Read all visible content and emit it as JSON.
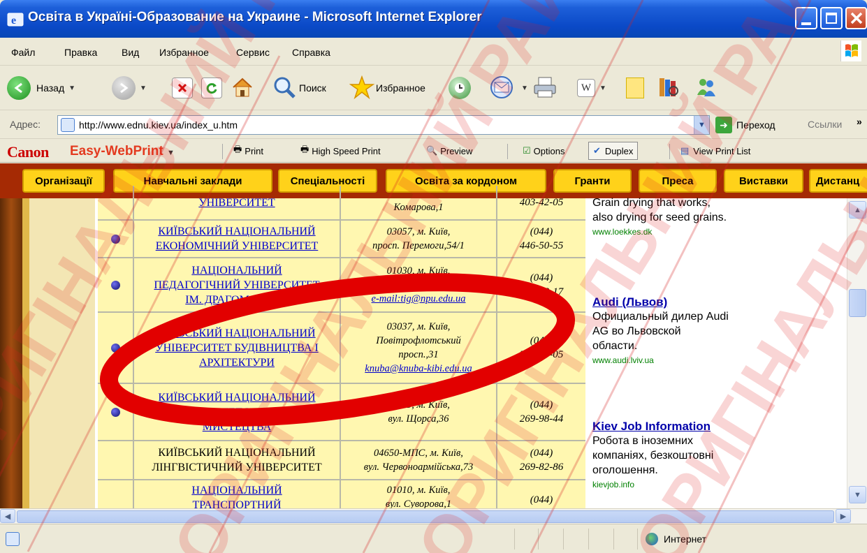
{
  "window": {
    "title": "Освіта в Україні-Образование на Украине - Microsoft Internet Explorer"
  },
  "menu": [
    "Файл",
    "Правка",
    "Вид",
    "Избранное",
    "Сервис",
    "Справка"
  ],
  "toolbar": {
    "back_label": "Назад",
    "search_label": "Поиск",
    "favorites_label": "Избранное"
  },
  "address": {
    "label": "Адрес:",
    "url": "http://www.ednu.kiev.ua/index_u.htm",
    "go_label": "Переход",
    "links_label": "Ссылки"
  },
  "canon": {
    "logo": "Canon",
    "product": "Easy-WebPrint",
    "buttons": [
      "Print",
      "High Speed Print",
      "Preview",
      "Options",
      "Duplex",
      "View Print List"
    ]
  },
  "nav": [
    "Організації",
    "Навчальні заклади",
    "Спеціальності",
    "Освіта за кордоном",
    "Гранти",
    "Преса",
    "Виставки",
    "Дистанц"
  ],
  "rows": [
    {
      "name": [
        "УНІВЕРСИТЕТ"
      ],
      "name_link": true,
      "addr": [
        "Комарова,1"
      ],
      "email": "",
      "phone": [
        "403-42-05"
      ]
    },
    {
      "name": [
        "КИЇВСЬКИЙ НАЦІОНАЛЬНИЙ",
        "ЕКОНОМІЧНИЙ УНІВЕРСИТЕТ"
      ],
      "name_link": true,
      "addr": [
        "03057, м. Київ,",
        "просп. Перемоги,54/1"
      ],
      "email": "",
      "phone": [
        "(044)",
        "446-50-55"
      ]
    },
    {
      "name": [
        "НАЦІОНАЛЬНИЙ",
        "ПЕДАГОГІЧНИЙ УНІВЕРСИТЕТ",
        "ІМ. ДРАГОМАНОВА"
      ],
      "name_link": true,
      "addr": [
        "01030, м. Київ,",
        "вул. Пирогова, 9"
      ],
      "email": "e-mail:tig@npu.edu.ua",
      "phone": [
        "(044)",
        "239-30-17"
      ]
    },
    {
      "name": [
        "КИЇВСЬКИЙ НАЦІОНАЛЬНИЙ",
        "УНІВЕРСИТЕТ БУДІВНИЦТВА І",
        "АРХІТЕКТУРИ"
      ],
      "name_link": true,
      "addr": [
        "03037, м. Київ,",
        "Повітрофлотський",
        "просп.,31"
      ],
      "email": "knuba@knuba-kibi.edu.ua",
      "phone": [
        "(044)",
        "248-49-05"
      ]
    },
    {
      "name": [
        "КИЇВСЬКИЙ НАЦІОНАЛЬНИЙ",
        "УНІВЕРСИТЕТ КУЛЬТУРИ І",
        "МИСТЕЦТВА"
      ],
      "name_link": true,
      "addr": [
        "01133, м. Київ,",
        "вул. Щорса,36"
      ],
      "email": "",
      "phone": [
        "(044)",
        "269-98-44"
      ]
    },
    {
      "name": [
        "КИЇВСЬКИЙ НАЦІОНАЛЬНИЙ",
        "ЛІНГВІСТИЧНИЙ УНІВЕРСИТЕТ"
      ],
      "name_link": false,
      "addr": [
        "04650-МПС, м. Київ,",
        "вул. Червоноармійська,73"
      ],
      "email": "",
      "phone": [
        "(044)",
        "269-82-86"
      ]
    },
    {
      "name": [
        "НАЦІОНАЛЬНИЙ",
        "ТРАНСПОРТНИЙ"
      ],
      "name_link": true,
      "addr": [
        "01010, м. Київ,",
        "вул. Суворова,1"
      ],
      "email": "",
      "phone": [
        "(044)"
      ]
    }
  ],
  "ads": [
    {
      "title": "",
      "lines": [
        "Grain drying that works,",
        "also drying for seed grains."
      ],
      "url": "www.loekkes.dk"
    },
    {
      "title": "Audi (Львов)",
      "lines": [
        "Официальный дилер Audi",
        "AG во Львовской",
        "области."
      ],
      "url": "www.audi.lviv.ua"
    },
    {
      "title": "Kiev Job Information",
      "lines": [
        "Робота в іноземних",
        "компаніях, безкоштовні",
        "оголошення."
      ],
      "url": "kievjob.info"
    }
  ],
  "status": {
    "zone": "Интернет"
  },
  "watermark": "ОРИГІНАЛЬНИЙ РАЙОН"
}
